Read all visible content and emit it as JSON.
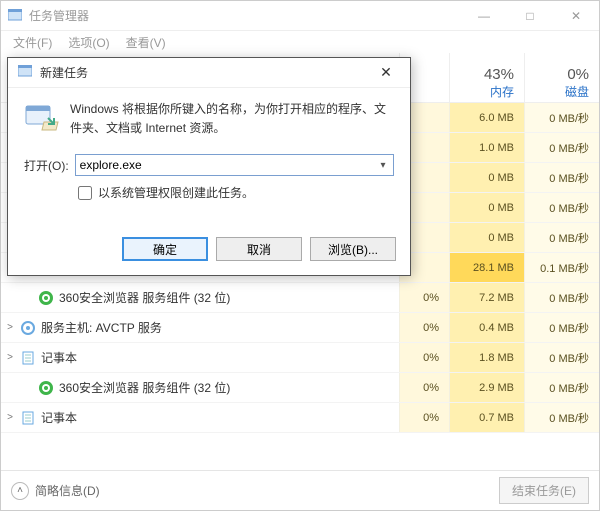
{
  "window": {
    "title": "任务管理器",
    "minimize": "—",
    "maximize": "□",
    "close": "✕"
  },
  "menu": {
    "file": "文件(F)",
    "options": "选项(O)",
    "view": "查看(V)"
  },
  "columns": {
    "mem_pct": "43%",
    "mem_label": "内存",
    "disk_pct": "0%",
    "disk_label": "磁盘"
  },
  "rows": [
    {
      "cpu": "",
      "mem": "6.0 MB",
      "disk": "0 MB/秒",
      "mem_high": false
    },
    {
      "cpu": "",
      "mem": "1.0 MB",
      "disk": "0 MB/秒",
      "mem_high": false
    },
    {
      "cpu": "",
      "mem": "0 MB",
      "disk": "0 MB/秒",
      "mem_high": false
    },
    {
      "cpu": "",
      "mem": "0 MB",
      "disk": "0 MB/秒",
      "mem_high": false
    },
    {
      "cpu": "",
      "mem": "0 MB",
      "disk": "0 MB/秒",
      "mem_high": false
    },
    {
      "cpu": "",
      "mem": "28.1 MB",
      "disk": "0.1 MB/秒",
      "mem_high": true
    },
    {
      "name": "360安全浏览器 服务组件 (32 位)",
      "icon": "360",
      "exp": "",
      "cpu": "0%",
      "mem": "7.2 MB",
      "disk": "0 MB/秒",
      "indent": true
    },
    {
      "name": "服务主机: AVCTP 服务",
      "icon": "svc",
      "exp": ">",
      "cpu": "0%",
      "mem": "0.4 MB",
      "disk": "0 MB/秒"
    },
    {
      "name": "记事本",
      "icon": "note",
      "exp": ">",
      "cpu": "0%",
      "mem": "1.8 MB",
      "disk": "0 MB/秒"
    },
    {
      "name": "360安全浏览器 服务组件 (32 位)",
      "icon": "360",
      "exp": "",
      "cpu": "0%",
      "mem": "2.9 MB",
      "disk": "0 MB/秒",
      "indent": true
    },
    {
      "name": "记事本",
      "icon": "note",
      "exp": ">",
      "cpu": "0%",
      "mem": "0.7 MB",
      "disk": "0 MB/秒"
    }
  ],
  "footer": {
    "brief": "简略信息(D)",
    "end": "结束任务(E)"
  },
  "dialog": {
    "title": "新建任务",
    "desc": "Windows 将根据你所键入的名称，为你打开相应的程序、文件夹、文档或 Internet 资源。",
    "open_label": "打开(O):",
    "value": "explore.exe",
    "admin_label": "以系统管理权限创建此任务。",
    "ok": "确定",
    "cancel": "取消",
    "browse": "浏览(B)..."
  }
}
